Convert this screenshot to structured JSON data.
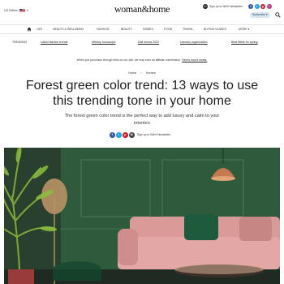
{
  "header": {
    "edition": "US Edition",
    "logo": "woman&home",
    "signup": "Sign up to W&H Newsletter",
    "subscribe": "Subscribe ▾",
    "socials": [
      "f",
      "t",
      "p",
      "i"
    ]
  },
  "nav": {
    "items": [
      "LIFE",
      "HEALTH & WELLBEING",
      "FASHION",
      "BEAUTY",
      "HOMES",
      "FOOD",
      "TRAVEL",
      "BUYING GUIDES",
      "MORE ▾"
    ]
  },
  "trending": {
    "label": "TRENDING",
    "items": [
      "Latest fashion trends",
      "Weekly horoscope",
      "Nail trends 2022",
      "Laundry organization",
      "Best fitbits for spring"
    ]
  },
  "disclaimer": {
    "text": "When you purchase through links on our site, we may earn an affiliate commission.",
    "link": "Here's how it works."
  },
  "breadcrumb": [
    "Home",
    "Homes"
  ],
  "article": {
    "title": "Forest green color trend: 13 ways to use this trending tone in your home",
    "subtitle": "The forest green color trend is the perfect way to add luxury and calm to your interiors",
    "share_label": "Sign up to W&H Newsletter"
  },
  "colors": {
    "facebook": "#3b5998",
    "twitter": "#1da1f2",
    "pinterest": "#cb2027",
    "instagram": "#c13584",
    "forest_green": "#2f5a3c",
    "pink_sofa": "#d99a98"
  }
}
